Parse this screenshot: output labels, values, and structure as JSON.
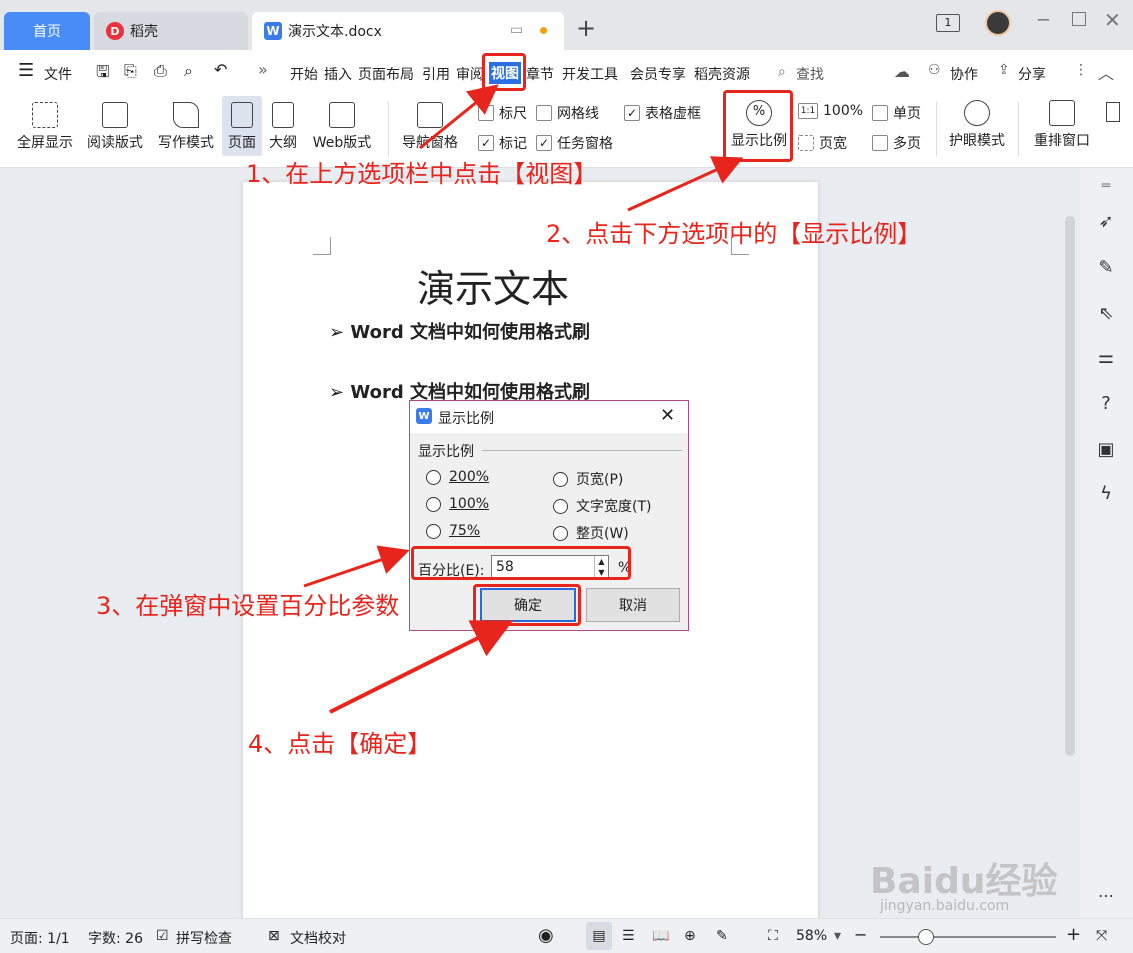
{
  "tabs": {
    "home": "首页",
    "daoke": "稻壳",
    "doc": "演示文本.docx",
    "new_tab": "+"
  },
  "window": {
    "badge": "1"
  },
  "menu": {
    "file": "文件",
    "items": [
      "开始",
      "插入",
      "页面布局",
      "引用",
      "审阅",
      "视图",
      "章节",
      "开发工具",
      "会员专享",
      "稻壳资源"
    ],
    "search": "查找",
    "collab": "协作",
    "share": "分享"
  },
  "ribbon": {
    "fullscreen": "全屏显示",
    "reading": "阅读版式",
    "writing": "写作模式",
    "page": "页面",
    "outline": "大纲",
    "web": "Web版式",
    "nav_pane": "导航窗格",
    "ruler": "标尺",
    "gridlines": "网格线",
    "table_gridlines": "表格虚框",
    "markup": "标记",
    "task_pane": "任务窗格",
    "zoom": "显示比例",
    "zoom_100": "100%",
    "page_width": "页宽",
    "single_page": "单页",
    "multi_page": "多页",
    "eye_mode": "护眼模式",
    "rearrange": "重排窗口"
  },
  "document": {
    "title": "演示文本",
    "bullets": [
      "Word 文档中如何使用格式刷",
      "Word 文档中如何使用格式刷"
    ]
  },
  "dialog": {
    "title": "显示比例",
    "group": "显示比例",
    "options_left": [
      "200%",
      "100%",
      "75%"
    ],
    "options_right": [
      "页宽(P)",
      "文字宽度(T)",
      "整页(W)"
    ],
    "percent_label": "百分比(E):",
    "percent_value": "58",
    "percent_unit": "%",
    "ok": "确定",
    "cancel": "取消"
  },
  "annotations": {
    "step1": "1、在上方选项栏中点击【视图】",
    "step2": "2、点击下方选项中的【显示比例】",
    "step3": "3、在弹窗中设置百分比参数",
    "step4": "4、点击【确定】"
  },
  "status": {
    "page": "页面: 1/1",
    "words": "字数: 26",
    "spell": "拼写检查",
    "proof": "文档校对",
    "zoom": "58%"
  },
  "watermark": {
    "text": "Baidu经验",
    "url": "jingyan.baidu.com"
  },
  "colors": {
    "accent": "#4a8cf7",
    "annotation": "#e8251c"
  }
}
